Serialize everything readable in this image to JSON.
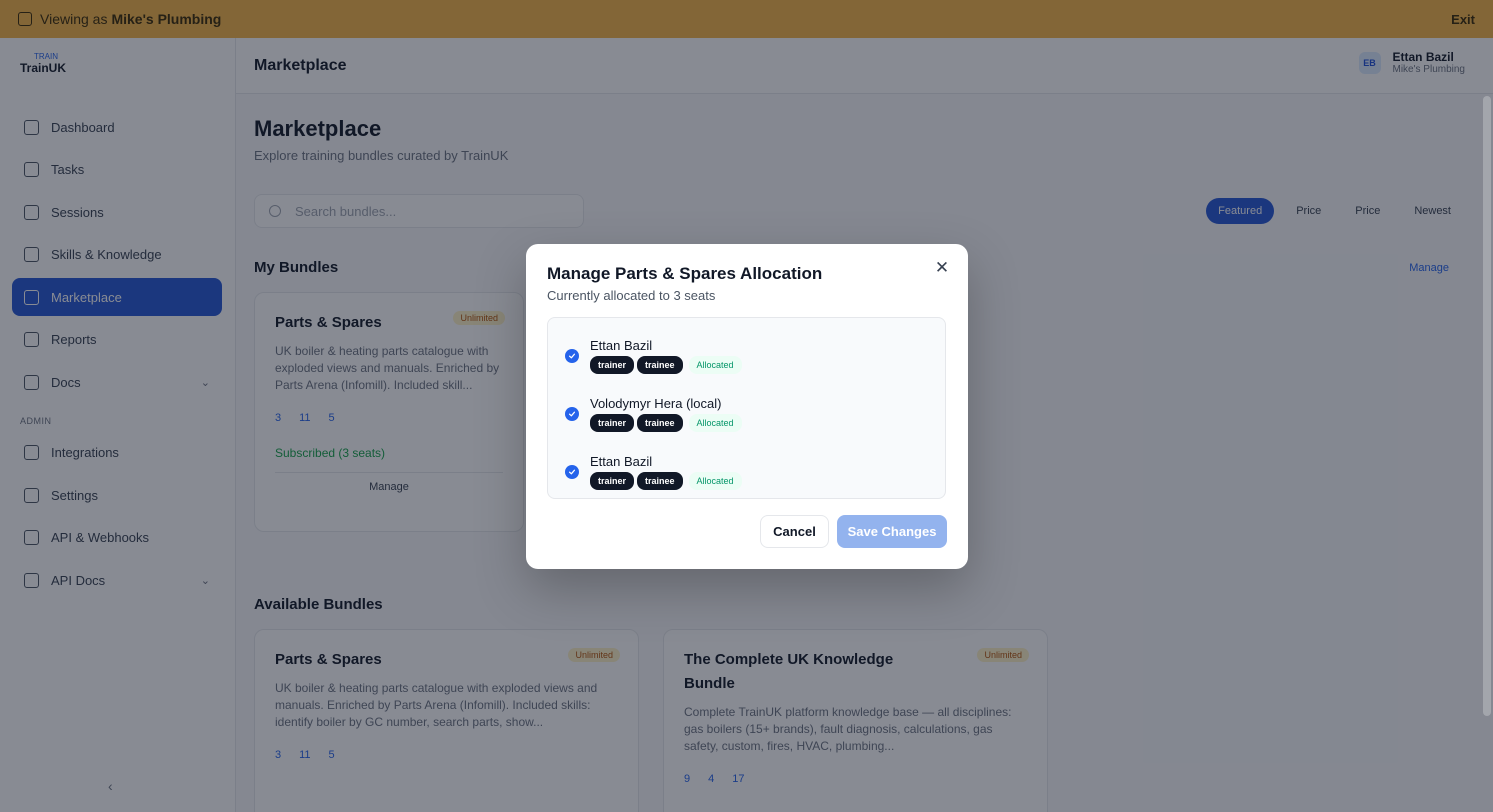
{
  "banner": {
    "prefix": "Viewing as",
    "org": "Mike's Plumbing",
    "exit": "Exit"
  },
  "logo": {
    "top": "TRAIN",
    "bottom": "TrainUK"
  },
  "sidebar": {
    "items": [
      {
        "label": "Dashboard"
      },
      {
        "label": "Tasks"
      },
      {
        "label": "Sessions"
      },
      {
        "label": "Skills & Knowledge"
      },
      {
        "label": "Marketplace"
      },
      {
        "label": "Reports"
      },
      {
        "label": "Docs"
      }
    ],
    "section_label": "Admin",
    "admin_items": [
      {
        "label": "Integrations"
      },
      {
        "label": "Settings"
      },
      {
        "label": "API & Webhooks"
      },
      {
        "label": "API Docs"
      }
    ]
  },
  "topbar": {
    "title": "Marketplace",
    "user_name": "Ettan Bazil",
    "user_org": "Mike's Plumbing",
    "avatar": "EB"
  },
  "page": {
    "title": "Marketplace",
    "subtitle": "Explore training bundles curated by TrainUK",
    "search_placeholder": "Search bundles...",
    "filters": [
      "Featured",
      "Price",
      "Price",
      "Newest"
    ],
    "my_bundles": "My Bundles",
    "manage_all": "Manage",
    "available_bundles": "Available Bundles"
  },
  "my_cards": [
    {
      "title": "Parts & Spares",
      "badge": "Unlimited",
      "desc": "UK boiler & heating parts catalogue with exploded views and manuals. Enriched by Parts Arena (Infomill). Included skill...",
      "stats": [
        "3",
        "11",
        "5"
      ],
      "subscribed": "Subscribed (3 seats)",
      "manage": "Manage"
    }
  ],
  "available_cards": [
    {
      "title": "Parts & Spares",
      "badge": "Unlimited",
      "desc": "UK boiler & heating parts catalogue with exploded views and manuals. Enriched by Parts Arena (Infomill). Included skills: identify boiler by GC number, search parts, show...",
      "stats": [
        "3",
        "11",
        "5"
      ]
    },
    {
      "title": "The Complete UK Knowledge Bundle",
      "badge": "Unlimited",
      "desc": "Complete TrainUK platform knowledge base — all disciplines: gas boilers (15+ brands), fault diagnosis, calculations, gas safety, custom, fires, HVAC, plumbing...",
      "stats": [
        "9",
        "4",
        "17"
      ]
    }
  ],
  "modal": {
    "title": "Manage Parts & Spares Allocation",
    "subtitle": "Currently allocated to 3 seats",
    "seats": [
      {
        "name": "Ettan Bazil",
        "roles": [
          "trainer",
          "trainee"
        ],
        "status": "Allocated"
      },
      {
        "name": "Volodymyr Hera (local)",
        "roles": [
          "trainer",
          "trainee"
        ],
        "status": "Allocated"
      },
      {
        "name": "Ettan Bazil",
        "roles": [
          "trainer",
          "trainee"
        ],
        "status": "Allocated"
      }
    ],
    "cancel_label": "Cancel",
    "save_label": "Save Changes"
  }
}
